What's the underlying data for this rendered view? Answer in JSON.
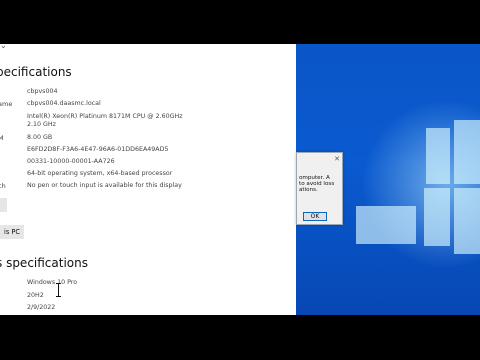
{
  "settings": {
    "device_specs_title": "pecifications",
    "device_rows": [
      {
        "label": "",
        "value": "cbpvs004"
      },
      {
        "label": "ame",
        "value": "cbpvs004.daasmc.local"
      },
      {
        "label": "",
        "value": "Intel(R) Xeon(R) Platinum 8171M CPU @ 2.60GHz"
      },
      {
        "label": "",
        "value": "2.10 GHz"
      },
      {
        "label": "M",
        "value": "8.00 GB"
      },
      {
        "label": "",
        "value": "E6FD2D8F-F3A6-4E47-96A6-01DD6EA49AD5"
      },
      {
        "label": "",
        "value": "00331-10000-00001-AA726"
      },
      {
        "label": "",
        "value": "64-bit operating system, x64-based processor"
      },
      {
        "label": "ch",
        "value": "No pen or touch input is available for this display"
      }
    ],
    "rename_button": "is PC",
    "windows_specs_title": "s specifications",
    "windows_rows": [
      {
        "value": "Windows 10 Pro"
      },
      {
        "value": "20H2"
      },
      {
        "value": "2/9/2022"
      }
    ]
  },
  "dialog": {
    "line1": "omputer. A",
    "line2": "to avoid loss",
    "line3": "ations.",
    "ok_label": "OK",
    "close_glyph": "✕"
  }
}
